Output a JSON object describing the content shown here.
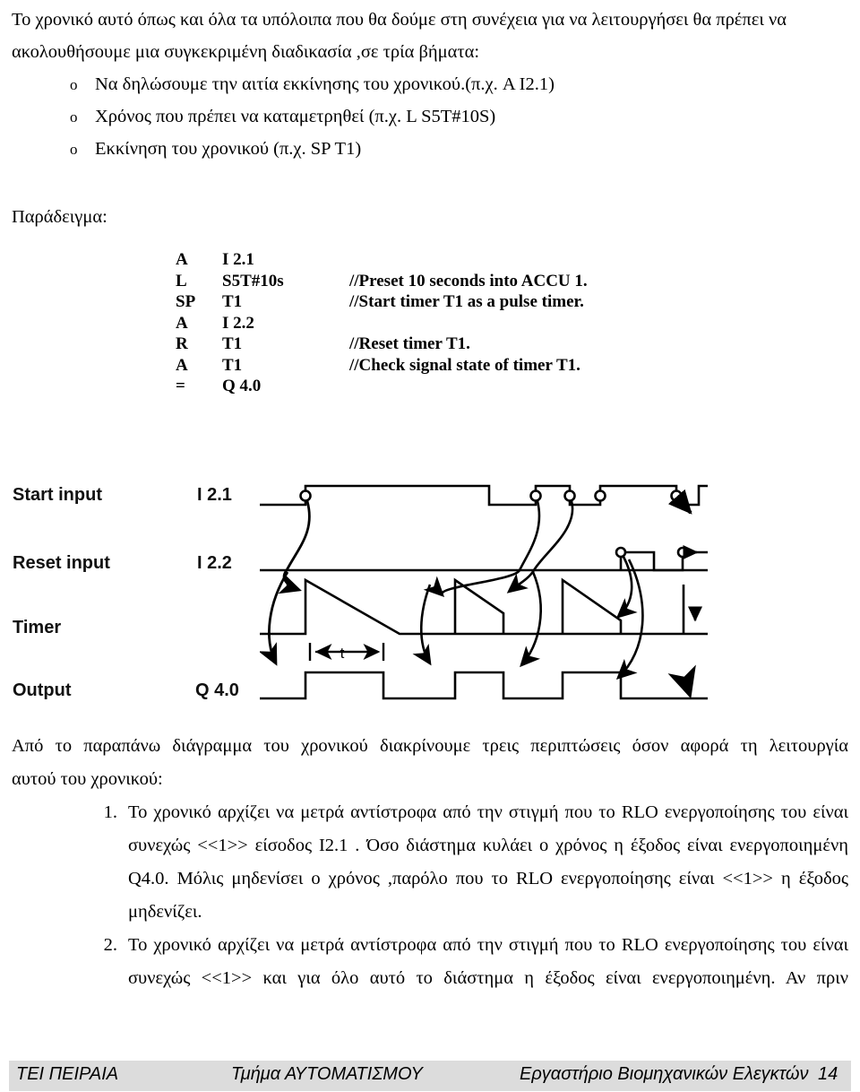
{
  "intro": {
    "line1": "Το χρονικό αυτό όπως και όλα τα υπόλοιπα που θα δούμε στη συνέχεια για να λειτουργήσει θα πρέπει να",
    "line2": "ακολουθήσουμε μια συγκεκριμένη διαδικασία ,σε τρία βήματα:"
  },
  "steps": {
    "marker": "o",
    "items": [
      "Να δηλώσουμε την αιτία εκκίνησης του χρονικού.(π.χ. A I2.1)",
      "Χρόνος που πρέπει να καταμετρηθεί (π.χ. L S5T#10S)",
      "Εκκίνηση του χρονικού (π.χ.  SP T1)"
    ]
  },
  "example": {
    "label": "Παράδειγμα:",
    "code": [
      {
        "op": "A",
        "arg": "I 2.1",
        "comment": ""
      },
      {
        "op": "L",
        "arg": "S5T#10s",
        "comment": "//Preset 10 seconds into ACCU 1."
      },
      {
        "op": "SP",
        "arg": "T1",
        "comment": "//Start timer T1 as a pulse timer."
      },
      {
        "op": "A",
        "arg": "I 2.2",
        "comment": ""
      },
      {
        "op": "R",
        "arg": "T1",
        "comment": "//Reset timer T1."
      },
      {
        "op": "A",
        "arg": "T1",
        "comment": "//Check signal state of timer T1."
      },
      {
        "op": "=",
        "arg": "Q 4.0",
        "comment": ""
      }
    ]
  },
  "diagram": {
    "rows": [
      {
        "label": "Start input",
        "address": "I 2.1"
      },
      {
        "label": "Reset input",
        "address": "I 2.2"
      },
      {
        "label": "Timer",
        "address": ""
      },
      {
        "label": "Output",
        "address": "Q 4.0"
      }
    ],
    "duration_label": "t"
  },
  "body": {
    "p1_line1": "Από το παραπάνω διάγραμμα του χρονικού διακρίνουμε τρεις περιπτώσεις όσον αφορά τη λειτουργία",
    "p1_line2": "αυτού του χρονικού:",
    "items": [
      {
        "marker": "1.",
        "lines": [
          "Το χρονικό αρχίζει να μετρά αντίστροφα από την στιγμή που το RLO ενεργοποίησης του είναι",
          "συνεχώς <<1>> είσοδος I2.1 . Όσο διάστημα κυλάει ο χρόνος η έξοδος είναι ενεργοποιημένη",
          "Q4.0. Μόλις μηδενίσει ο χρόνος ,παρόλο που το RLO  ενεργοποίησης είναι <<1>> η έξοδος",
          "μηδενίζει."
        ]
      },
      {
        "marker": "2.",
        "lines": [
          "Το χρονικό αρχίζει να μετρά αντίστροφα από την στιγμή που το RLO ενεργοποίησης  του είναι",
          "συνεχώς <<1>> και για όλο αυτό το διάστημα η έξοδος είναι ενεργοποιημένη. Αν πριν"
        ]
      }
    ]
  },
  "footer": {
    "left": "ΤΕΙ ΠΕΙΡΑΙΑ",
    "center": "Τμήμα ΑΥΤΟΜΑΤΙΣΜΟΥ",
    "right": "Εργαστήριο Βιομηχανικών Ελεγκτών",
    "page": "14",
    "background": "#dcdcdc"
  }
}
